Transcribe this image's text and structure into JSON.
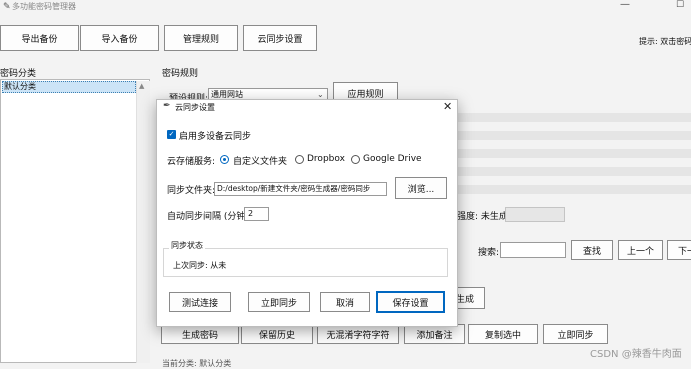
{
  "window": {
    "title": "多功能密码管理器",
    "minimize_glyph": "—",
    "maximize_glyph": "☐"
  },
  "toolbar": {
    "export_label": "导出备份",
    "import_label": "导入备份",
    "manage_rules_label": "管理规则",
    "cloud_sync_label": "云同步设置",
    "hint": "提示: 双击密码可"
  },
  "left_panel": {
    "title": "密码分类",
    "items": [
      {
        "label": "默认分类"
      }
    ]
  },
  "main": {
    "title": "密码规则",
    "preset_label": "预设规则:",
    "preset_value": "通用网站",
    "apply_rule_label": "应用规则",
    "strength_label": "强度: 未生成",
    "search_label": "搜索:",
    "search_value": "",
    "find_label": "查找",
    "prev_label": "上一个",
    "next_label": "下一",
    "generate_tail_label": "生成",
    "bottom_buttons": {
      "generate": "生成密码",
      "save_history": "保留历史",
      "no_confusing": "无混淆字符字符",
      "add_note": "添加备注",
      "copy_selected": "复制选中",
      "sync_now": "立即同步"
    },
    "bottom_text": "当前分类: 默认分类"
  },
  "dialog": {
    "title": "云同步设置",
    "close_glyph": "✕",
    "enable_sync_label": "启用多设备云同步",
    "enable_sync_checked": true,
    "storage_label": "云存储服务:",
    "storage_options": [
      "自定义文件夹",
      "Dropbox",
      "Google Drive"
    ],
    "storage_selected": "自定义文件夹",
    "folder_label": "同步文件夹:",
    "folder_value": "D:/desktop/新建文件夹/密码生成器/密码同步",
    "browse_label": "浏览...",
    "interval_label": "自动同步间隔 (分钟):",
    "interval_value": "2",
    "status_group_title": "同步状态",
    "last_sync_label": "上次同步: 从未",
    "buttons": {
      "test": "测试连接",
      "sync_now": "立即同步",
      "cancel": "取消",
      "save": "保存设置"
    }
  },
  "watermark": "CSDN @辣香牛肉面",
  "colors": {
    "accent": "#0067c0",
    "selection": "#cce4f7",
    "window_bg": "#f3f3f3"
  }
}
